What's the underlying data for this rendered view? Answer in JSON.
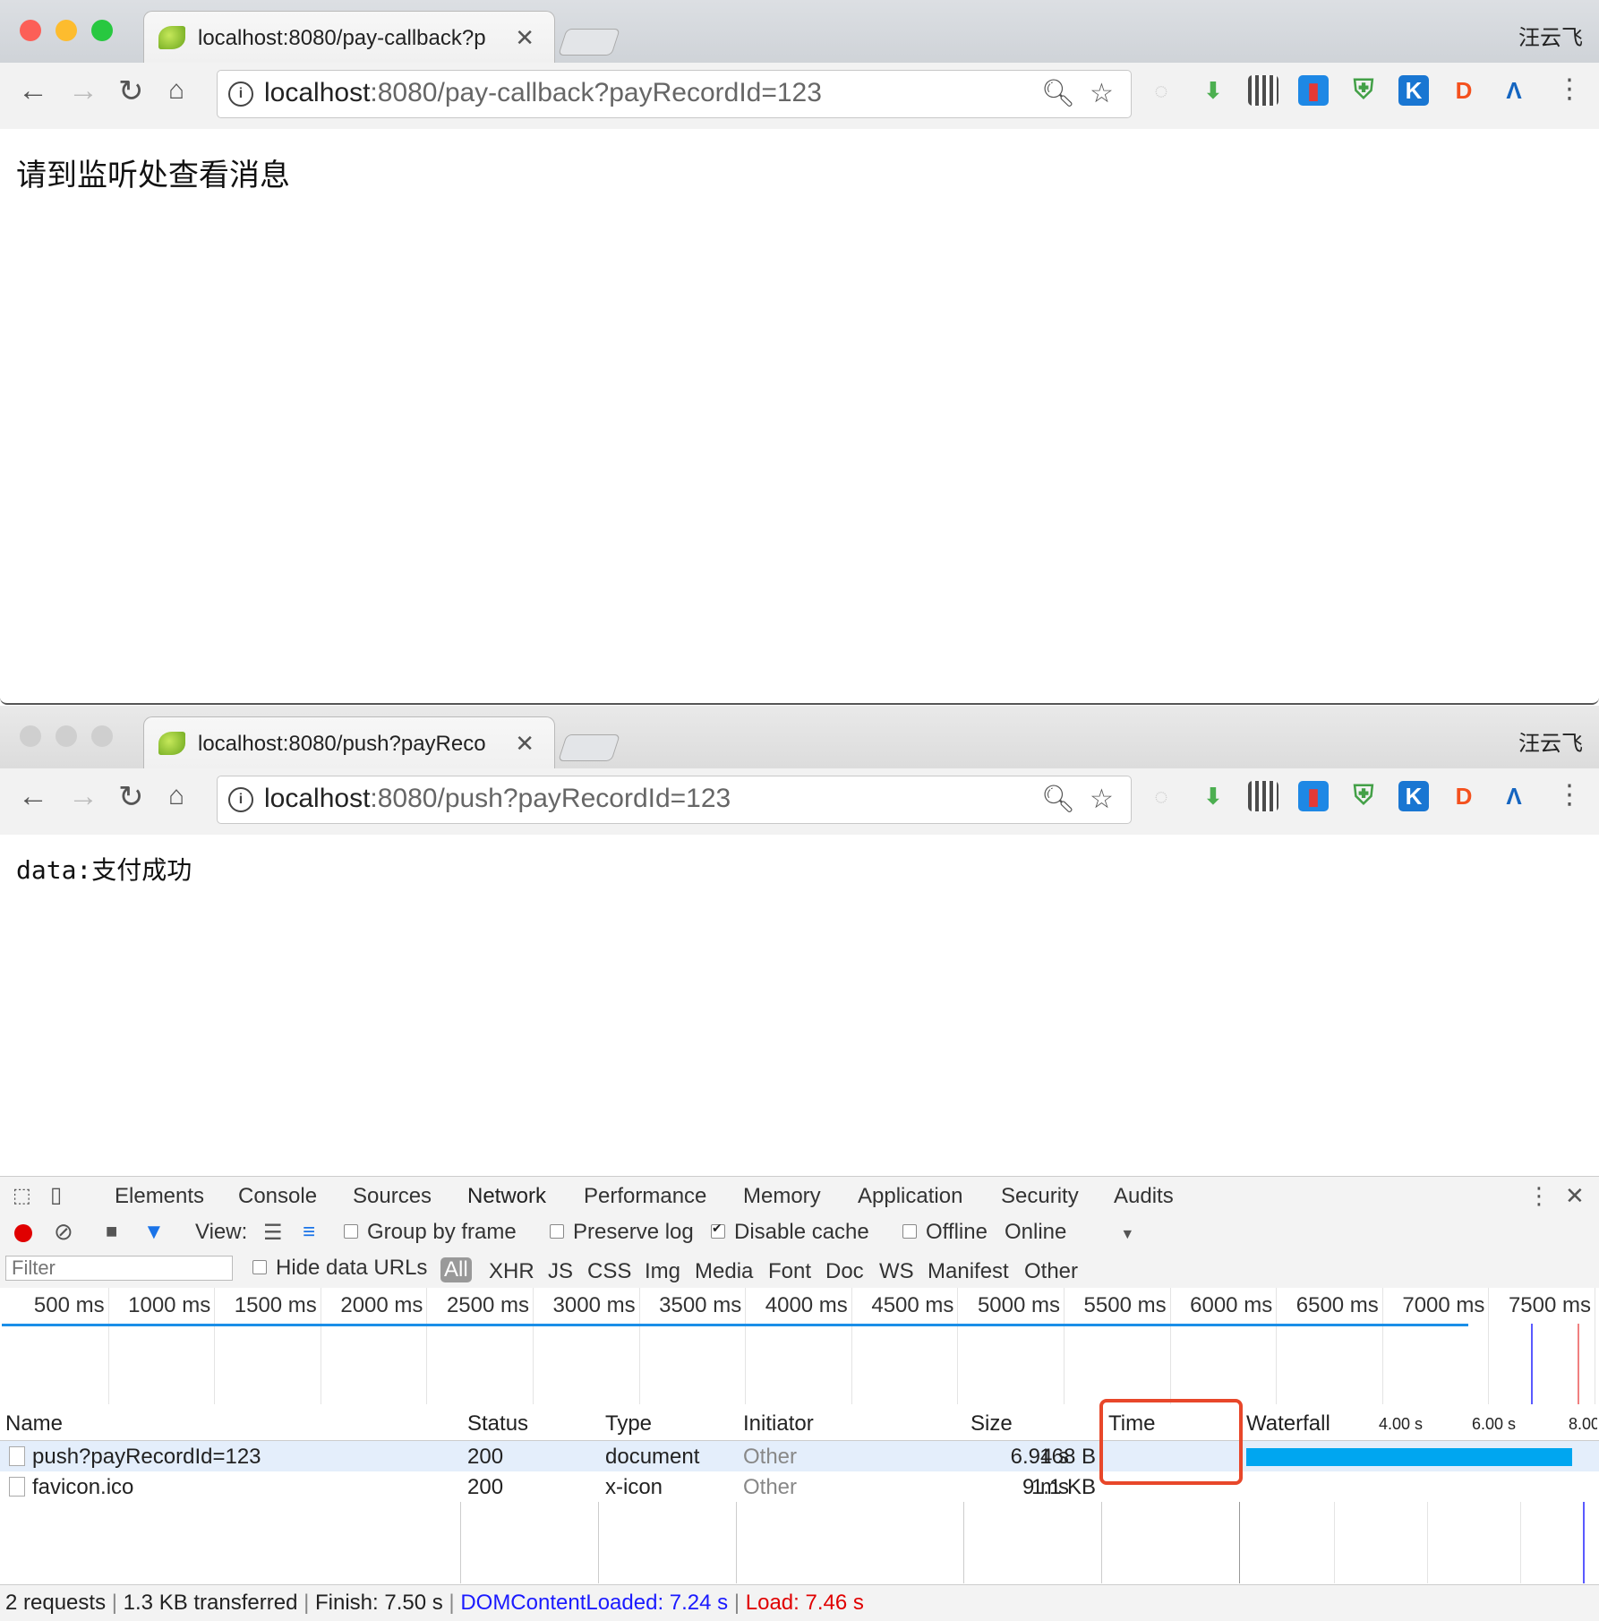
{
  "window1": {
    "tab_title": "localhost:8080/pay-callback?p",
    "user": "汪云飞",
    "url_host": "localhost",
    "url_rest": ":8080/pay-callback?payRecordId=123",
    "page_text": "请到监听处查看消息"
  },
  "window2": {
    "tab_title": "localhost:8080/push?payReco",
    "user": "汪云飞",
    "url_host": "localhost",
    "url_rest": ":8080/push?payRecordId=123",
    "page_text": "data:支付成功"
  },
  "devtools": {
    "tabs": [
      "Elements",
      "Console",
      "Sources",
      "Network",
      "Performance",
      "Memory",
      "Application",
      "Security",
      "Audits"
    ],
    "active_tab": "Network",
    "toolbar": {
      "view_label": "View:",
      "group_by_frame": "Group by frame",
      "preserve_log": "Preserve log",
      "disable_cache": "Disable cache",
      "offline": "Offline",
      "throttle": "Online"
    },
    "filter": {
      "placeholder": "Filter",
      "hide_data_urls": "Hide data URLs",
      "types": [
        "All",
        "XHR",
        "JS",
        "CSS",
        "Img",
        "Media",
        "Font",
        "Doc",
        "WS",
        "Manifest",
        "Other"
      ]
    },
    "timeline_ticks": [
      "500 ms",
      "1000 ms",
      "1500 ms",
      "2000 ms",
      "2500 ms",
      "3000 ms",
      "3500 ms",
      "4000 ms",
      "4500 ms",
      "5000 ms",
      "5500 ms",
      "6000 ms",
      "6500 ms",
      "7000 ms",
      "7500 ms"
    ],
    "columns": [
      "Name",
      "Status",
      "Type",
      "Initiator",
      "Size",
      "Time",
      "Waterfall"
    ],
    "waterfall_ticks": [
      "4.00 s",
      "6.00 s",
      "8.00"
    ],
    "rows": [
      {
        "name": "push?payRecordId=123",
        "status": "200",
        "type": "document",
        "initiator": "Other",
        "size": "168 B",
        "time": "6.94 s"
      },
      {
        "name": "favicon.ico",
        "status": "200",
        "type": "x-icon",
        "initiator": "Other",
        "size": "1.1 KB",
        "time": "9 ms"
      }
    ],
    "status": {
      "requests": "2 requests",
      "transferred": "1.3 KB transferred",
      "finish": "Finish: 7.50 s",
      "dom": "DOMContentLoaded: 7.24 s",
      "load": "Load: 7.46 s"
    }
  },
  "colors": {
    "dom": "#1a1aff",
    "load": "#e00000",
    "highlight": "#e8472a",
    "waterfall_bar": "#00a6f0"
  }
}
